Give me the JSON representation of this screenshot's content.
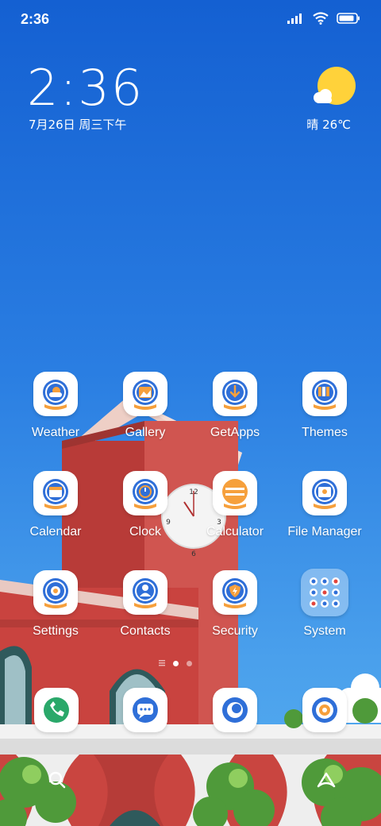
{
  "status_bar": {
    "time": "2:36",
    "icons": [
      "signal-icon",
      "wifi-icon",
      "battery-icon"
    ],
    "battery_level": 0.9
  },
  "clock_widget": {
    "time": "2:36",
    "date": "7月26日 周三下午"
  },
  "weather_widget": {
    "icon": "sun-cloud-icon",
    "text": "晴 26℃"
  },
  "apps": [
    {
      "label": "Weather",
      "icon": "weather-icon"
    },
    {
      "label": "Gallery",
      "icon": "gallery-icon"
    },
    {
      "label": "GetApps",
      "icon": "getapps-icon"
    },
    {
      "label": "Themes",
      "icon": "themes-icon"
    },
    {
      "label": "Calendar",
      "icon": "calendar-icon"
    },
    {
      "label": "Clock",
      "icon": "clock-icon"
    },
    {
      "label": "Calculator",
      "icon": "calculator-icon"
    },
    {
      "label": "File Manager",
      "icon": "file-manager-icon"
    },
    {
      "label": "Settings",
      "icon": "settings-icon"
    },
    {
      "label": "Contacts",
      "icon": "contacts-icon"
    },
    {
      "label": "Security",
      "icon": "security-icon"
    },
    {
      "label": "System",
      "icon": "system-folder-icon"
    }
  ],
  "page_indicator": {
    "pages": 3,
    "active": 1
  },
  "dock": [
    {
      "icon": "phone-icon"
    },
    {
      "icon": "messages-icon"
    },
    {
      "icon": "browser-icon"
    },
    {
      "icon": "camera-icon"
    }
  ],
  "bottom_bar": {
    "icons": [
      "search-icon",
      "app-vault-icon"
    ]
  },
  "colors": {
    "sky_top": "#1460d2",
    "sky_bottom": "#56aef0",
    "icon_blue": "#2f6fd8",
    "icon_orange": "#f6a03c",
    "tower_red": "#c8443f"
  }
}
